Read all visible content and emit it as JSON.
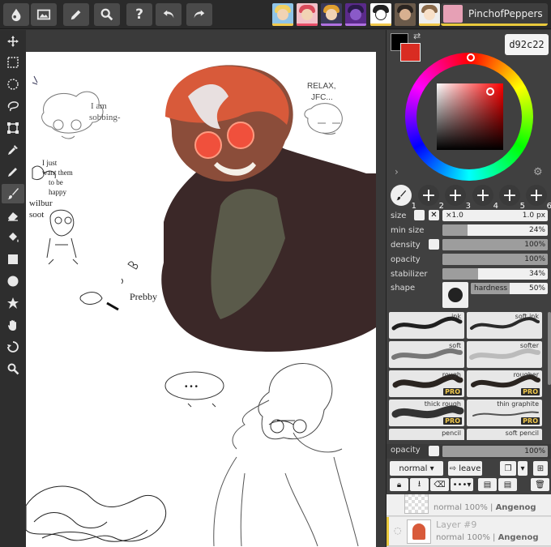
{
  "toolbar": {
    "buttons": [
      "app-logo-icon",
      "image-icon",
      "pencil-icon",
      "search-icon",
      "help-icon",
      "undo-icon",
      "redo-icon"
    ]
  },
  "user": {
    "name": "PinchofPeppers"
  },
  "color": {
    "hex": "d92c22",
    "primary": "#d92c22",
    "secondary": "#000000"
  },
  "brush_slots": [
    "1",
    "2",
    "3",
    "4",
    "5",
    "6"
  ],
  "brush_settings": {
    "size_label": "size",
    "size_multiplier": "×1.0",
    "size_value": "1.0 px",
    "min_size_label": "min size",
    "min_size_value": "24%",
    "min_size_level": 24,
    "density_label": "density",
    "density_value": "100%",
    "density_level": 100,
    "opacity_label": "opacity",
    "opacity_value": "100%",
    "opacity_level": 100,
    "stabilizer_label": "stabilizer",
    "stabilizer_value": "34%",
    "stabilizer_level": 34,
    "shape_label": "shape",
    "hardness_label": "hardness",
    "hardness_value": "50%",
    "hardness_level": 50
  },
  "presets": [
    {
      "label": "ink",
      "pro": false
    },
    {
      "label": "soft ink",
      "pro": false
    },
    {
      "label": "soft",
      "pro": false
    },
    {
      "label": "softer",
      "pro": false
    },
    {
      "label": "rough",
      "pro": true
    },
    {
      "label": "rougher",
      "pro": true
    },
    {
      "label": "thick rough",
      "pro": true
    },
    {
      "label": "thin graphite",
      "pro": true
    },
    {
      "label": "pencil",
      "pro": false
    },
    {
      "label": "soft pencil",
      "pro": false
    }
  ],
  "pro_badge": "PRO",
  "layer_opacity": {
    "label": "opacity",
    "value": "100%",
    "level": 100
  },
  "layer_controls": {
    "blend_mode": "normal",
    "leave_label": "leave"
  },
  "layers": [
    {
      "name": "",
      "blend": "normal",
      "opacity": "100%",
      "owner": "Angenog"
    },
    {
      "name": "Layer #9",
      "blend": "normal",
      "opacity": "100%",
      "owner": "Angenog"
    }
  ],
  "canvas_text": {
    "note_sobbing_1": "I am",
    "note_sobbing_2": "sobbing-",
    "note_relax_1": "RELAX,",
    "note_relax_2": "JFC...",
    "note_just_1": "I just",
    "note_just_2": "want them",
    "note_just_3": "to be",
    "note_just_4": "happy",
    "note_wilbur_1": "wilbur",
    "note_wilbur_2": "soot",
    "note_prebby": "Prebby",
    "speech_dots": "• • •"
  }
}
